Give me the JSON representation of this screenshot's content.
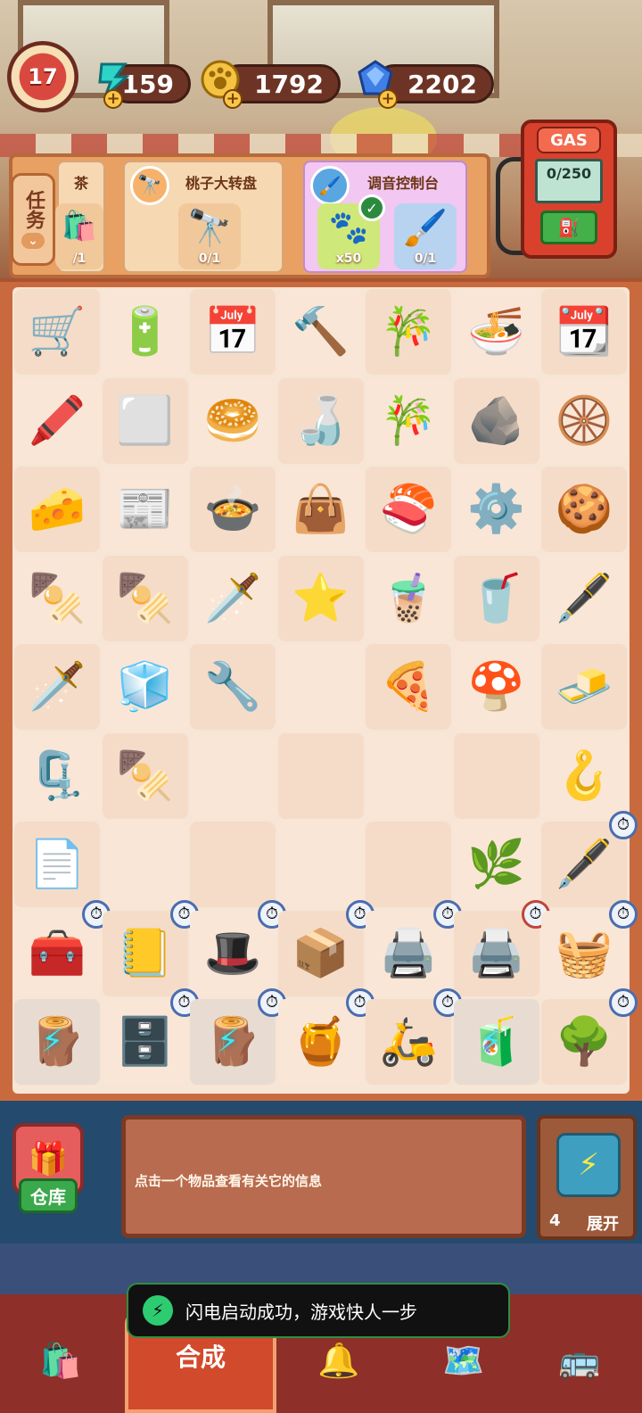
{
  "player": {
    "level": "17"
  },
  "currencies": [
    {
      "id": "energy",
      "value": "159",
      "icon": "lightning-icon",
      "color": "#2fd3c8"
    },
    {
      "id": "paws",
      "value": "1792",
      "icon": "paw-coin-icon",
      "color": "#f5c242"
    },
    {
      "id": "gems",
      "value": "2202",
      "icon": "diamond-icon",
      "color": "#3f7fe6"
    }
  ],
  "tasks": {
    "tab_label": "任务",
    "cards": [
      {
        "title": "茶",
        "items": [
          {
            "icon": "takeout-bag-icon",
            "count": "/1"
          }
        ]
      },
      {
        "title": "桃子大转盘",
        "items": [
          {
            "icon": "telescope-icon",
            "count": "0/1"
          }
        ]
      },
      {
        "title": "调音控制台",
        "items": [
          {
            "icon": "paw-coin-icon",
            "count": "x50",
            "done": true
          },
          {
            "icon": "brush-icon",
            "count": "0/1"
          }
        ]
      }
    ]
  },
  "gas_pump": {
    "label": "GAS",
    "value": "0/250"
  },
  "board": {
    "rows": [
      [
        "🛒",
        "🔋",
        "📅",
        "🔨",
        "🎋",
        "🍜",
        "📆"
      ],
      [
        "🖍️",
        "⬜",
        "🥯",
        "🍶",
        "🎋",
        "🪨",
        "🛞"
      ],
      [
        "🧀",
        "📰",
        "🍲",
        "👜",
        "🍣",
        "⚙️",
        "🍪"
      ],
      [
        "🍢",
        "🍢",
        "🗡️",
        "⭐",
        "🧋",
        "🥤",
        "🖋️"
      ],
      [
        "🗡️",
        "🧊",
        "🔧",
        "",
        "🍕",
        "🍄",
        "🧈"
      ],
      [
        "🗜️",
        "🍢",
        "",
        "",
        "",
        "",
        "🪝"
      ],
      [
        "📄",
        "",
        "",
        "",
        "",
        "🌿",
        "🖋️"
      ],
      [
        "🧰",
        "📒",
        "🎩",
        "📦",
        "🖨️",
        "🖨️",
        "🧺"
      ],
      [
        "🪵",
        "🗄️",
        "🪵",
        "🍯",
        "🛵",
        "🧃",
        "🌳"
      ]
    ],
    "timers": [
      [
        6,
        6
      ],
      [
        7,
        0
      ],
      [
        7,
        1
      ],
      [
        7,
        2
      ],
      [
        7,
        3
      ],
      [
        7,
        4
      ],
      [
        7,
        5
      ],
      [
        7,
        6
      ],
      [
        8,
        1
      ],
      [
        8,
        2
      ],
      [
        8,
        3
      ],
      [
        8,
        4
      ],
      [
        8,
        6
      ]
    ],
    "bolts": [
      [
        8,
        0
      ],
      [
        8,
        2
      ],
      [
        8,
        5
      ]
    ]
  },
  "info": {
    "warehouse_label": "仓库",
    "message": "点击一个物品查看有关它的信息",
    "expand_count": "4",
    "expand_label": "展开"
  },
  "toast": {
    "message": "闪电启动成功，游戏快人一步"
  },
  "nav": {
    "active_label": "合成"
  }
}
